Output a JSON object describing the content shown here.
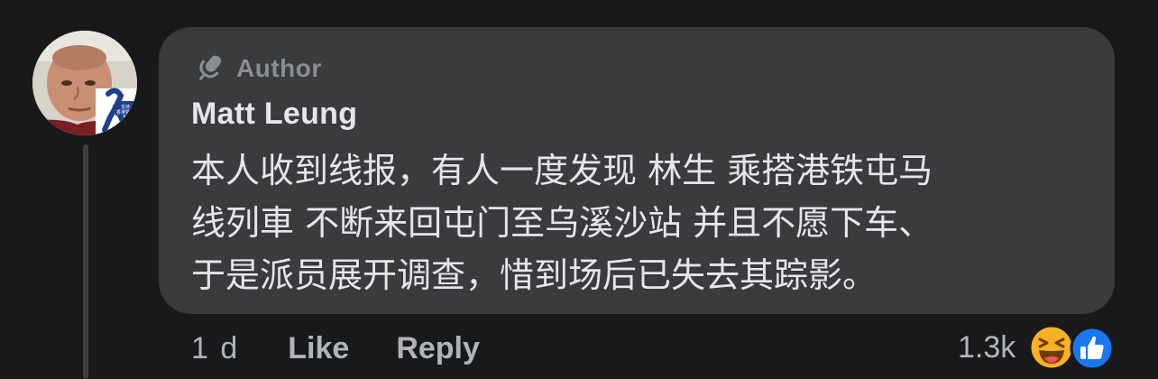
{
  "comment": {
    "author_badge": "Author",
    "name": "Matt Leung",
    "text_lines": [
      "本人收到线报，有人一度发现 林生 乘搭港铁屯马",
      "线列車 不断来回屯门至乌溪沙站 并且不愿下车、",
      "于是派员展开调查，惜到场后已失去其踪影。"
    ],
    "timestamp": "1 d",
    "actions": {
      "like": "Like",
      "reply": "Reply"
    },
    "reactions": {
      "count": "1.3k",
      "icons": [
        "haha-icon",
        "like-icon"
      ]
    },
    "avatar": {
      "ribbon_text": "支持香港警察"
    }
  },
  "colors": {
    "background": "#18191a",
    "bubble": "#3a3b3c",
    "primary_text": "#e4e6eb",
    "secondary_text": "#b0b3b8",
    "like_blue": "#1877f2",
    "haha_yellow": "#f7b125"
  }
}
